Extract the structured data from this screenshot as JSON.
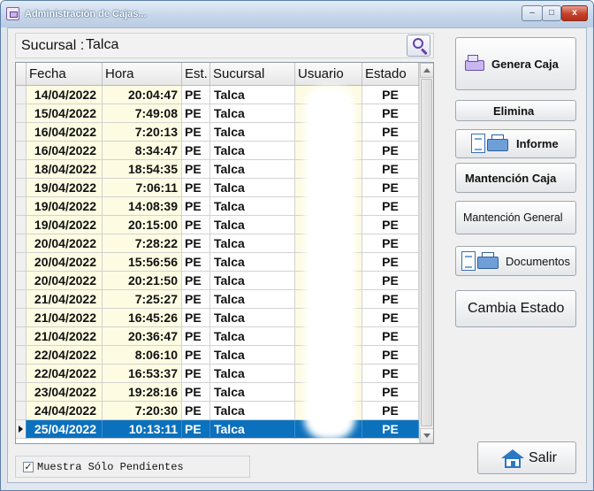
{
  "window": {
    "title": "Administración de Cajas...",
    "controls": {
      "minimize": "–",
      "maximize": "□",
      "close": "x"
    }
  },
  "branch": {
    "label": "Sucursal :",
    "value": "Talca"
  },
  "grid": {
    "columns": [
      "Fecha",
      "Hora",
      "Est.",
      "Sucursal",
      "Usuario",
      "Estado"
    ],
    "rows": [
      {
        "fecha": "14/04/2022",
        "hora": "20:04:47",
        "est": "PE",
        "sucursal": "Talca",
        "usuario": "",
        "estado": "PE"
      },
      {
        "fecha": "15/04/2022",
        "hora": "7:49:08",
        "est": "PE",
        "sucursal": "Talca",
        "usuario": "",
        "estado": "PE"
      },
      {
        "fecha": "16/04/2022",
        "hora": "7:20:13",
        "est": "PE",
        "sucursal": "Talca",
        "usuario": "",
        "estado": "PE"
      },
      {
        "fecha": "16/04/2022",
        "hora": "8:34:47",
        "est": "PE",
        "sucursal": "Talca",
        "usuario": "",
        "estado": "PE"
      },
      {
        "fecha": "18/04/2022",
        "hora": "18:54:35",
        "est": "PE",
        "sucursal": "Talca",
        "usuario": "",
        "estado": "PE"
      },
      {
        "fecha": "19/04/2022",
        "hora": "7:06:11",
        "est": "PE",
        "sucursal": "Talca",
        "usuario": "",
        "estado": "PE"
      },
      {
        "fecha": "19/04/2022",
        "hora": "14:08:39",
        "est": "PE",
        "sucursal": "Talca",
        "usuario": "",
        "estado": "PE"
      },
      {
        "fecha": "19/04/2022",
        "hora": "20:15:00",
        "est": "PE",
        "sucursal": "Talca",
        "usuario": "",
        "estado": "PE"
      },
      {
        "fecha": "20/04/2022",
        "hora": "7:28:22",
        "est": "PE",
        "sucursal": "Talca",
        "usuario": "",
        "estado": "PE"
      },
      {
        "fecha": "20/04/2022",
        "hora": "15:56:56",
        "est": "PE",
        "sucursal": "Talca",
        "usuario": "",
        "estado": "PE"
      },
      {
        "fecha": "20/04/2022",
        "hora": "20:21:50",
        "est": "PE",
        "sucursal": "Talca",
        "usuario": "",
        "estado": "PE"
      },
      {
        "fecha": "21/04/2022",
        "hora": "7:25:27",
        "est": "PE",
        "sucursal": "Talca",
        "usuario": "",
        "estado": "PE"
      },
      {
        "fecha": "21/04/2022",
        "hora": "16:45:26",
        "est": "PE",
        "sucursal": "Talca",
        "usuario": "",
        "estado": "PE"
      },
      {
        "fecha": "21/04/2022",
        "hora": "20:36:47",
        "est": "PE",
        "sucursal": "Talca",
        "usuario": "",
        "estado": "PE"
      },
      {
        "fecha": "22/04/2022",
        "hora": "8:06:10",
        "est": "PE",
        "sucursal": "Talca",
        "usuario": "",
        "estado": "PE"
      },
      {
        "fecha": "22/04/2022",
        "hora": "16:53:37",
        "est": "PE",
        "sucursal": "Talca",
        "usuario": "",
        "estado": "PE"
      },
      {
        "fecha": "23/04/2022",
        "hora": "19:28:16",
        "est": "PE",
        "sucursal": "Talca",
        "usuario": "",
        "estado": "PE"
      },
      {
        "fecha": "24/04/2022",
        "hora": "7:20:30",
        "est": "PE",
        "sucursal": "Talca",
        "usuario": "",
        "estado": "PE"
      },
      {
        "fecha": "25/04/2022",
        "hora": "10:13:11",
        "est": "PE",
        "sucursal": "Talca",
        "usuario": "",
        "estado": "PE"
      }
    ],
    "selected_row": 18
  },
  "buttons": {
    "genera_caja": "Genera Caja",
    "elimina": "Elimina",
    "informe": "Informe",
    "mantencion_caja": "Mantención Caja",
    "mantencion_general": "Mantención General",
    "documentos": "Documentos",
    "cambia_estado": "Cambia Estado",
    "salir": "Salir"
  },
  "filter": {
    "label": "Muestra Sólo Pendientes",
    "checked": true,
    "check_mark": "✓"
  }
}
